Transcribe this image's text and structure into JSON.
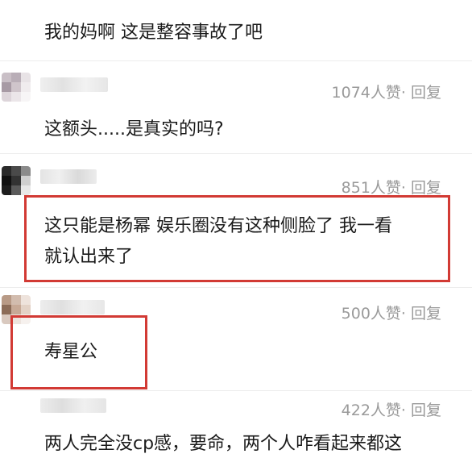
{
  "comments": [
    {
      "text": "我的妈啊 这是整容事故了吧"
    },
    {
      "likes": "1074人赞",
      "reply": "· 回复",
      "text": "这额头.....是真实的吗?"
    },
    {
      "likes": "851人赞",
      "reply": "· 回复",
      "text_line1": "这只能是杨幂 娱乐圈没有这种侧脸了 我一看",
      "text_line2": "就认出来了"
    },
    {
      "likes": "500人赞",
      "reply": "· 回复",
      "text": "寿星公"
    },
    {
      "likes": "422人赞",
      "reply": "· 回复",
      "text": "两人完全没cp感，要命，两个人咋看起来都这"
    }
  ],
  "colors": {
    "highlight": "#d23a34",
    "meta": "#9a9a9a"
  }
}
